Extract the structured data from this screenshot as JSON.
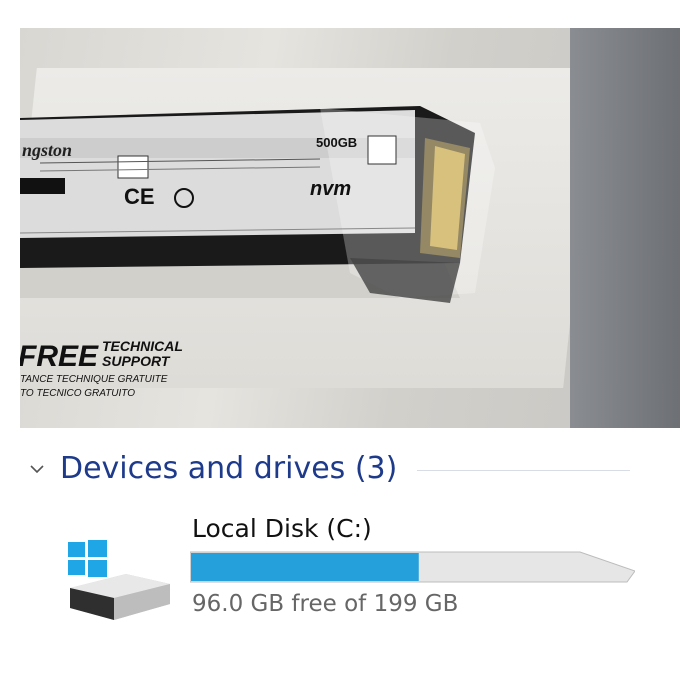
{
  "photo": {
    "brand_text": "ngston",
    "capacity_text": "500GB",
    "free_tech_line1": "FREE",
    "free_tech_line2": "TECHNICAL",
    "free_tech_line3": "SUPPORT",
    "free_tech_line4": "TANCE TECHNIQUE GRATUITE",
    "free_tech_line5": "TO TECNICO GRATUITO",
    "nvme_text": "nvm"
  },
  "section": {
    "title": "Devices and drives (3)"
  },
  "drive": {
    "name": "Local Disk (C:)",
    "free_text": "96.0 GB free of 199 GB",
    "used_fraction": 0.52,
    "bar_color": "#26a0da",
    "track_color": "#e6e6e6"
  },
  "colors": {
    "section_title": "#1e3a8a",
    "windows_logo": "#1fa6e6"
  },
  "icons": {
    "chevron": "chevron-down-icon",
    "drive": "hard-drive-icon",
    "windows": "windows-logo-icon"
  }
}
